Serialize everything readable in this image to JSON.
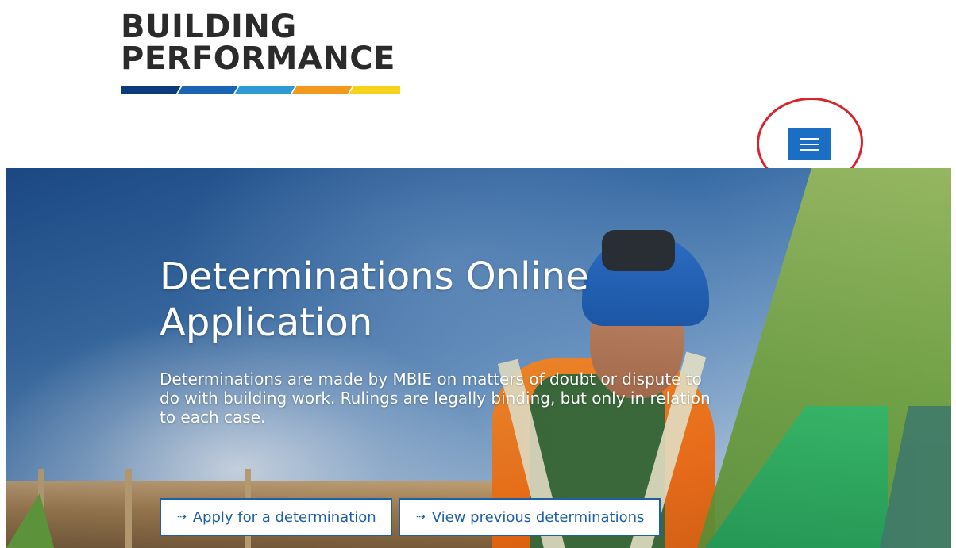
{
  "logo": {
    "line1": "BUILDING",
    "line2": "PERFORMANCE",
    "bar_colors": [
      "#0b3b7a",
      "#1a64b3",
      "#2f9bd6",
      "#f39a1e",
      "#f7d21a"
    ]
  },
  "menu_button": {
    "label": "Menu",
    "color": "#1a6fc4",
    "highlight_color": "#d8242b"
  },
  "hero": {
    "title": "Determinations Online Application",
    "description": "Determinations are made by MBIE on matters of doubt or dispute to do with building work. Rulings are legally binding, but only in relation to each case.",
    "buttons": [
      {
        "arrow": "⇢",
        "label": "Apply for a determination"
      },
      {
        "arrow": "⇢",
        "label": "View previous determinations"
      }
    ],
    "button_color": "#1d5fa8"
  }
}
